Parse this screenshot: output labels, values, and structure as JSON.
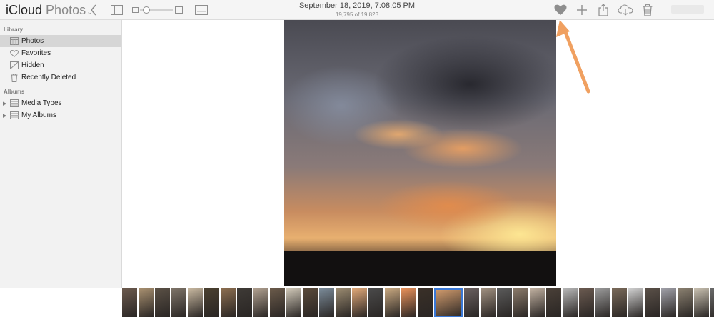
{
  "app": {
    "brand": "iCloud",
    "app_name": "Photos",
    "menu_caret": "⌄"
  },
  "toolbar": {
    "date": "September 18, 2019, 7:08:05 PM",
    "count": "19,795 of 19,823",
    "icons": [
      "back-chevron-icon",
      "sidebar-toggle-icon",
      "zoom-out-icon",
      "zoom-slider",
      "zoom-in-icon",
      "info-icon",
      "heart-icon",
      "plus-icon",
      "share-icon",
      "download-icon",
      "trash-icon"
    ]
  },
  "sidebar": {
    "library_label": "Library",
    "albums_label": "Albums",
    "library_items": [
      {
        "label": "Photos",
        "icon": "photos-icon",
        "selected": true
      },
      {
        "label": "Favorites",
        "icon": "heart-icon",
        "selected": false
      },
      {
        "label": "Hidden",
        "icon": "hidden-icon",
        "selected": false
      },
      {
        "label": "Recently Deleted",
        "icon": "trash-icon",
        "selected": false
      }
    ],
    "album_items": [
      {
        "label": "Media Types",
        "icon": "folder-icon",
        "expander": "▶"
      },
      {
        "label": "My Albums",
        "icon": "folder-icon",
        "expander": "▶"
      }
    ]
  },
  "colors": {
    "toolbar_bg": "#f5f5f5",
    "sidebar_bg": "#f2f2f2",
    "selected_row": "#d6d6d6",
    "icon_gray": "#8e8e8e",
    "annotation_arrow": "#f0a060"
  },
  "filmstrip": {
    "thumbnails": [
      "#6b5a4e",
      "#a89070",
      "#5a5045",
      "#7d7368",
      "#c8b8a0",
      "#4a4030",
      "#8c6e50",
      "#3e3a36",
      "#b0a090",
      "#6a5a4a",
      "#d0c8b8",
      "#5a4a3a",
      "#7a8a98",
      "#9a8a70",
      "#e0a878",
      "#4a4a4a",
      "#c8a880",
      "#e8905a",
      "#3a3028",
      "#d8a070",
      "#6a6060",
      "#a09080",
      "#5a5a5a",
      "#8a7a6a",
      "#c0b0a0",
      "#4a4038",
      "#b8b8b8",
      "#6a5a50",
      "#9a9a9a",
      "#7a6a5a",
      "#d0d0d0",
      "#5a5048",
      "#a0a0a8",
      "#8a8070",
      "#c8c0b0",
      "#6a6a6a",
      "#b0a8a0",
      "#4a4a50",
      "#9a8a7a",
      "#7a7a7a"
    ],
    "selected_index": 19
  }
}
